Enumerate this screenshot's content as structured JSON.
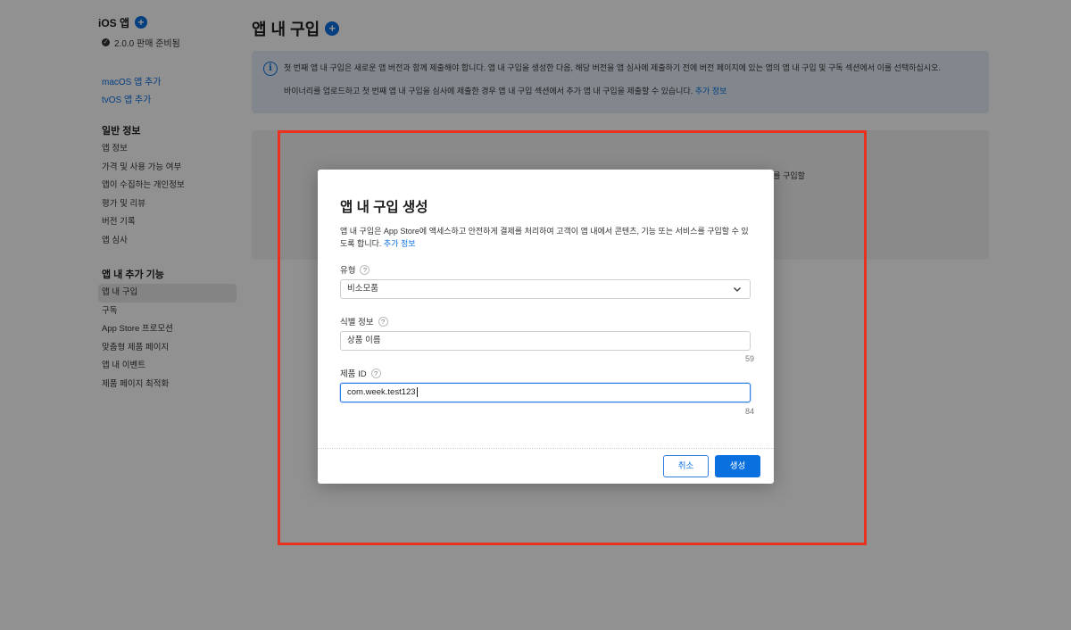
{
  "sidebar": {
    "app_name": "iOS 앱",
    "version_status": "2.0.0 판매 준비됨",
    "links": [
      "macOS 앱 추가",
      "tvOS 앱 추가"
    ],
    "general_section": {
      "heading": "일반 정보",
      "items": [
        "앱 정보",
        "가격 및 사용 가능 여부",
        "앱이 수집하는 개인정보",
        "평가 및 리뷰",
        "버전 기록",
        "앱 심사"
      ]
    },
    "features_section": {
      "heading": "앱 내 추가 기능",
      "items": [
        "앱 내 구입",
        "구독",
        "App Store 프로모션",
        "맞춤형 제품 페이지",
        "앱 내 이벤트",
        "제품 페이지 최적화"
      ],
      "active_index": 0
    }
  },
  "main": {
    "title": "앱 내 구입",
    "info_banner": {
      "line1": "첫 번째 앱 내 구입은 새로운 앱 버전과 함께 제출해야 합니다. 앱 내 구입을 생성한 다음, 해당 버전을 앱 심사에 제출하기 전에 버전 페이지에 있는 앱의 앱 내 구입 및 구독 섹션에서 이를 선택하십시오.",
      "line2": "바이너리를 업로드하고 첫 번째 앱 내 구입을 심사에 제출한 경우 앱 내 구입 섹션에서 추가 앱 내 구입을 제출할 수 있습니다.",
      "link": "추가 정보"
    },
    "card_text_fragment": "스를 구입할"
  },
  "modal": {
    "title": "앱 내 구입 생성",
    "description": "앱 내 구입은 App Store에 액세스하고 안전하게 결제를 처리하여 고객이 앱 내에서 콘텐츠, 기능 또는 서비스를 구입할 수 있도록 합니다.",
    "description_link": "추가 정보",
    "type_field": {
      "label": "유형",
      "value": "비소모품"
    },
    "reference_field": {
      "label": "식별 정보",
      "placeholder": "상품 이름",
      "counter": "59"
    },
    "product_id_field": {
      "label": "제품 ID",
      "value": "com.week.test123",
      "counter": "84"
    },
    "cancel_label": "취소",
    "create_label": "생성"
  },
  "colors": {
    "accent": "#0a70e0",
    "highlight_frame": "#e8311e",
    "info_banner_bg": "#e4eef8"
  },
  "icons": {
    "plus": "plus-circle-icon",
    "check": "checkmark-circle-icon",
    "info": "info-circle-icon",
    "help": "question-circle-icon",
    "chevron": "chevron-down-icon"
  }
}
